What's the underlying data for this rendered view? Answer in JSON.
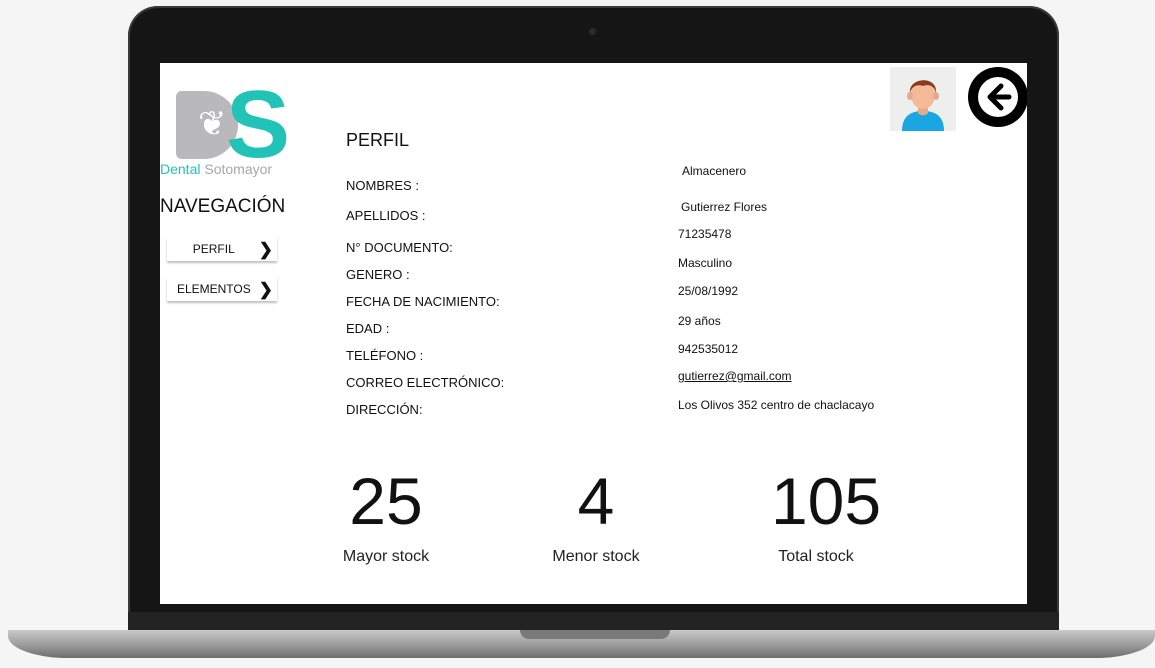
{
  "brand": {
    "logo_letters": "DS",
    "name_part1": "Dental",
    "name_part2": "Sotomayor",
    "accent_color": "#22c3b7",
    "gray_color": "#b9b9bb"
  },
  "nav": {
    "title": "NAVEGACIÓN",
    "items": [
      {
        "label": "PERFIL",
        "icon": "chevron-right-icon"
      },
      {
        "label": "ELEMENTOS",
        "icon": "chevron-right-icon"
      }
    ]
  },
  "header": {
    "avatar_icon": "user-avatar-icon",
    "back_icon": "arrow-left-icon"
  },
  "profile": {
    "title": "PERFIL",
    "fields": [
      {
        "label": "NOMBRES :",
        "value": "Almacenero"
      },
      {
        "label": "APELLIDOS :",
        "value": "Gutierrez Flores"
      },
      {
        "label": "N° DOCUMENTO:",
        "value": "71235478"
      },
      {
        "label": "GENERO :",
        "value": "Masculino"
      },
      {
        "label": "FECHA DE NACIMIENTO:",
        "value": "25/08/1992"
      },
      {
        "label": "EDAD :",
        "value": "29 años"
      },
      {
        "label": "TELÉFONO :",
        "value": "942535012"
      },
      {
        "label": "CORREO ELECTRÓNICO:",
        "value": "gutierrez@gmail.com"
      },
      {
        "label": "DIRECCIÓN:",
        "value": "Los Olivos 352 centro de chaclacayo"
      }
    ]
  },
  "stats": [
    {
      "value": "25",
      "label": "Mayor stock"
    },
    {
      "value": "4",
      "label": "Menor stock"
    },
    {
      "value": "105",
      "label": "Total stock"
    }
  ]
}
